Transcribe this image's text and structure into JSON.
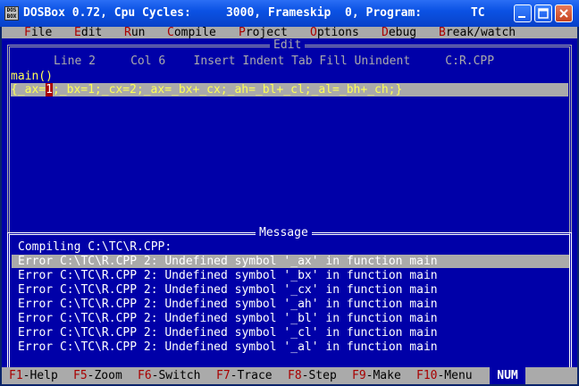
{
  "window": {
    "title": "DOSBox 0.72, Cpu Cycles:     3000, Frameskip  0, Program:       TC",
    "icon_text": "DOS BOX"
  },
  "menu": [
    {
      "hotkey": "F",
      "rest": "ile"
    },
    {
      "hotkey": "E",
      "rest": "dit"
    },
    {
      "hotkey": "R",
      "rest": "un"
    },
    {
      "hotkey": "C",
      "rest": "ompile"
    },
    {
      "hotkey": "P",
      "rest": "roject"
    },
    {
      "hotkey": "O",
      "rest": "ptions"
    },
    {
      "hotkey": "D",
      "rest": "ebug"
    },
    {
      "hotkey": "B",
      "rest": "reak/watch"
    }
  ],
  "editor": {
    "title": "Edit",
    "status": "Line 2     Col 6    Insert Indent Tab Fill Unindent     C:R.CPP",
    "line1": "main()",
    "line2_before": "{_ax=",
    "line2_cursor": "1",
    "line2_after": ";_bx=1;_cx=2;_ax=_bx+_cx;_ah=_bl+_cl;_al=_bh+_ch;}"
  },
  "messages": {
    "title": "Message",
    "lines": [
      "Compiling C:\\TC\\R.CPP:",
      "Error C:\\TC\\R.CPP 2: Undefined symbol '_ax' in function main",
      "Error C:\\TC\\R.CPP 2: Undefined symbol '_bx' in function main",
      "Error C:\\TC\\R.CPP 2: Undefined symbol '_cx' in function main",
      "Error C:\\TC\\R.CPP 2: Undefined symbol '_ah' in function main",
      "Error C:\\TC\\R.CPP 2: Undefined symbol '_bl' in function main",
      "Error C:\\TC\\R.CPP 2: Undefined symbol '_cl' in function main",
      "Error C:\\TC\\R.CPP 2: Undefined symbol '_al' in function main"
    ]
  },
  "function_keys": [
    {
      "key": "F1",
      "label": "-Help"
    },
    {
      "key": "F5",
      "label": "-Zoom"
    },
    {
      "key": "F6",
      "label": "-Switch"
    },
    {
      "key": "F7",
      "label": "-Trace"
    },
    {
      "key": "F8",
      "label": "-Step"
    },
    {
      "key": "F9",
      "label": "-Make"
    },
    {
      "key": "F10",
      "label": "-Menu"
    }
  ],
  "num_indicator": "NUM",
  "colors": {
    "dos_blue": "#0000a8",
    "dos_gray": "#aaaaaa",
    "dos_red": "#a80000",
    "dos_yellow": "#ffff55",
    "xp_title_blue": "#0b52e4"
  }
}
